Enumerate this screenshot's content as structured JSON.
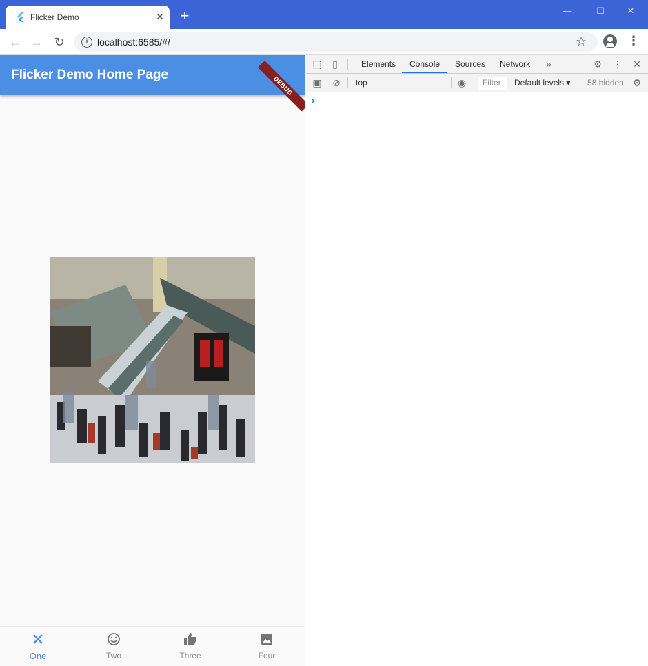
{
  "browser": {
    "tab_title": "Flicker Demo",
    "new_tab_label": "+",
    "url": "localhost:6585/#/"
  },
  "app": {
    "title": "Flicker Demo Home Page",
    "debug_banner": "DEBUG",
    "accent_color": "#4a8fe4",
    "bottom_nav": [
      {
        "label": "One",
        "icon": "close-icon",
        "active": true
      },
      {
        "label": "Two",
        "icon": "smiley-icon",
        "active": false
      },
      {
        "label": "Three",
        "icon": "thumbs-up-icon",
        "active": false
      },
      {
        "label": "Four",
        "icon": "image-icon",
        "active": false
      }
    ]
  },
  "devtools": {
    "tabs": [
      "Elements",
      "Console",
      "Sources",
      "Network"
    ],
    "active_tab": "Console",
    "context": "top",
    "filter_placeholder": "Filter",
    "levels": "Default levels",
    "hidden_count": "58 hidden"
  }
}
